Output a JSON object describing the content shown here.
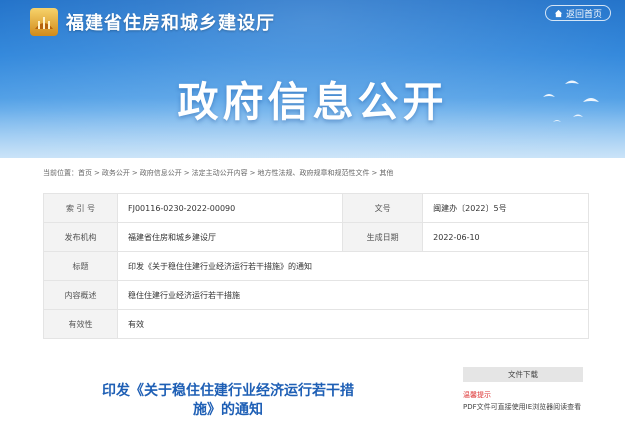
{
  "header": {
    "site_name": "福建省住房和城乡建设厅",
    "home_button": "返回首页",
    "banner_title": "政府信息公开"
  },
  "breadcrumb": {
    "prefix": "当前位置：",
    "items": [
      "首页",
      "政务公开",
      "政府信息公开",
      "法定主动公开内容",
      "地方性法规、政府规章和规范性文件",
      "其他"
    ],
    "separator": ">"
  },
  "info": {
    "index_label": "索 引 号",
    "index_value": "FJ00116-0230-2022-00090",
    "docno_label": "文号",
    "docno_value": "闽建办〔2022〕5号",
    "org_label": "发布机构",
    "org_value": "福建省住房和城乡建设厅",
    "date_label": "生成日期",
    "date_value": "2022-06-10",
    "title_label": "标题",
    "title_value": "印发《关于稳住住建行业经济运行若干措施》的通知",
    "summary_label": "内容概述",
    "summary_value": "稳住住建行业经济运行若干措施",
    "validity_label": "有效性",
    "validity_value": "有效"
  },
  "document": {
    "title_line1": "印发《关于稳住住建行业经济运行若干措",
    "title_line2": "施》的通知"
  },
  "sidebar": {
    "download_button": "文件下载",
    "tip_label": "温馨提示",
    "tip_text": "PDF文件可直接使用IE浏览器阅读查看"
  },
  "colors": {
    "banner_blue": "#2f86db",
    "title_blue": "#1e5fb5",
    "tip_red": "#dd3333"
  }
}
